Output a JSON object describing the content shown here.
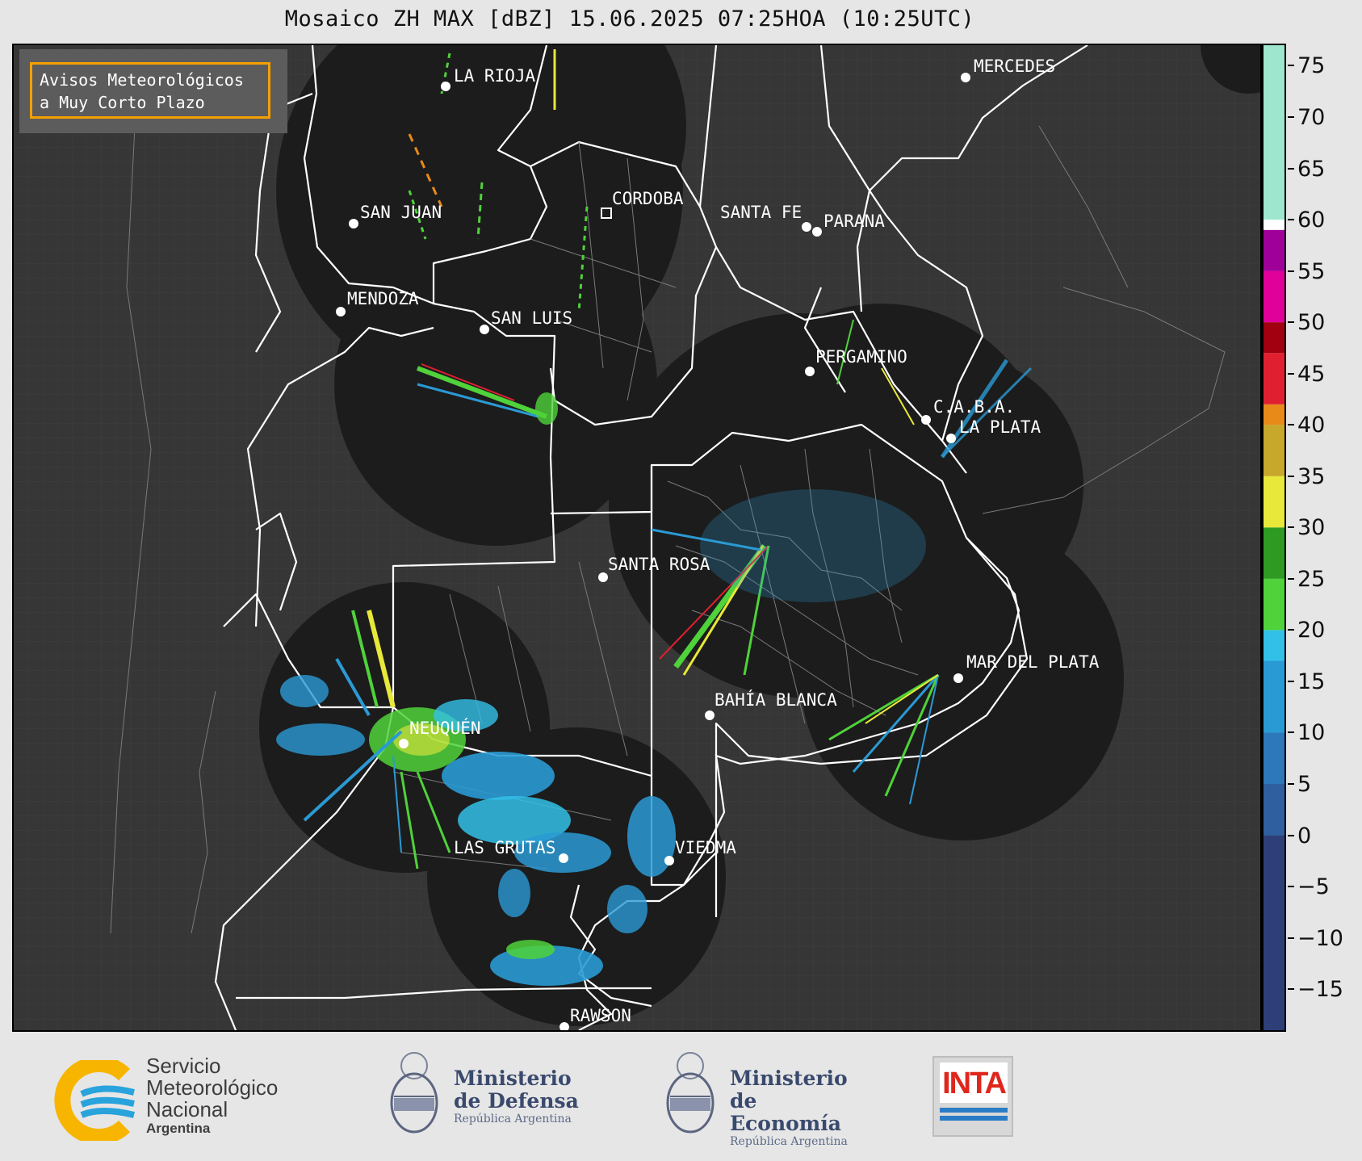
{
  "title": "Mosaico ZH MAX [dBZ] 15.06.2025 07:25HOA (10:25UTC)",
  "notice": {
    "line1": "Avisos Meteorológicos",
    "line2": "a Muy Corto Plazo"
  },
  "cities": [
    {
      "name": "LA RIOJA"
    },
    {
      "name": "MERCEDES"
    },
    {
      "name": "CORDOBA"
    },
    {
      "name": "SAN JUAN"
    },
    {
      "name": "SANTA FE"
    },
    {
      "name": "PARANA"
    },
    {
      "name": "MENDOZA"
    },
    {
      "name": "SAN LUIS"
    },
    {
      "name": "PERGAMINO"
    },
    {
      "name": "C.A.B.A."
    },
    {
      "name": "LA PLATA"
    },
    {
      "name": "SANTA ROSA"
    },
    {
      "name": "MAR DEL PLATA"
    },
    {
      "name": "BAHÍA BLANCA"
    },
    {
      "name": "NEUQUÉN"
    },
    {
      "name": "LAS GRUTAS"
    },
    {
      "name": "VIEDMA"
    },
    {
      "name": "RAWSON"
    }
  ],
  "colorbar": {
    "unit": "dBZ",
    "ticks": [
      "75",
      "70",
      "65",
      "60",
      "55",
      "50",
      "45",
      "40",
      "35",
      "30",
      "25",
      "20",
      "15",
      "10",
      "5",
      "0",
      "−5",
      "−10",
      "−15"
    ],
    "range": [
      -19,
      77
    ],
    "bands": [
      {
        "from": -19,
        "to": 0,
        "color": "#2e3f78"
      },
      {
        "from": 0,
        "to": 5,
        "color": "#2f5f9e"
      },
      {
        "from": 5,
        "to": 10,
        "color": "#2c78b8"
      },
      {
        "from": 10,
        "to": 17,
        "color": "#2a9ad4"
      },
      {
        "from": 17,
        "to": 20,
        "color": "#33c0e8"
      },
      {
        "from": 20,
        "to": 25,
        "color": "#4fd23a"
      },
      {
        "from": 25,
        "to": 30,
        "color": "#2e9a22"
      },
      {
        "from": 30,
        "to": 35,
        "color": "#e8e83a"
      },
      {
        "from": 35,
        "to": 40,
        "color": "#c8a82a"
      },
      {
        "from": 40,
        "to": 42,
        "color": "#e88a1a"
      },
      {
        "from": 42,
        "to": 47,
        "color": "#e02030"
      },
      {
        "from": 47,
        "to": 50,
        "color": "#a00010"
      },
      {
        "from": 50,
        "to": 55,
        "color": "#e0009a"
      },
      {
        "from": 55,
        "to": 59,
        "color": "#a0009a"
      },
      {
        "from": 59,
        "to": 60,
        "color": "#ffffff"
      },
      {
        "from": 60,
        "to": 77,
        "color": "#9fe6cf"
      }
    ]
  },
  "logos": {
    "smn": {
      "line1": "Servicio",
      "line2": "Meteorológico",
      "line3": "Nacional",
      "sub": "Argentina"
    },
    "defensa": {
      "line1": "Ministerio",
      "line2": "de Defensa",
      "sub": "República Argentina"
    },
    "economia": {
      "line1": "Ministerio",
      "line2": "de Economía",
      "sub": "República Argentina"
    },
    "inta": {
      "text": "INTA"
    }
  },
  "colors": {
    "background": "#363636",
    "radar_coverage": "#1c1c1c",
    "borders": "#ffffff",
    "notice_border": "#f5a000"
  }
}
